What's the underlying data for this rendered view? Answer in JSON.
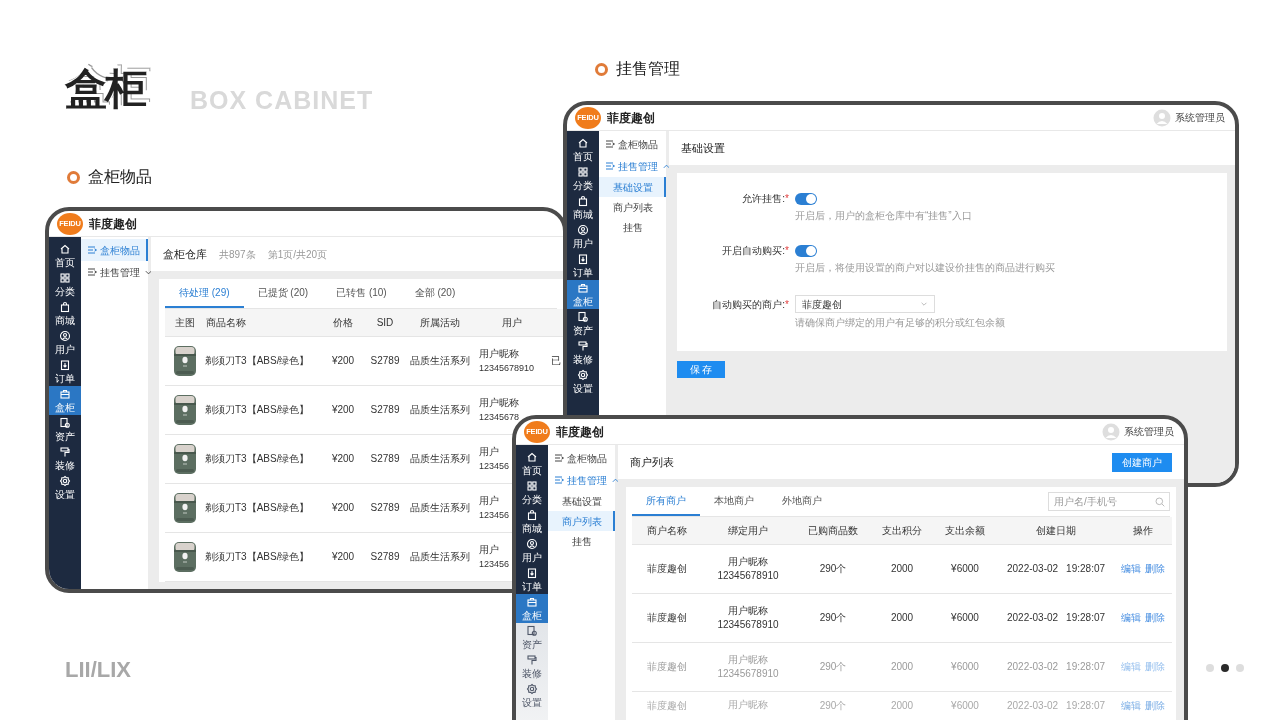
{
  "brand": {
    "title": "盒柜",
    "subtitle": "BOX CABINET"
  },
  "sections": [
    {
      "label": "盒柜物品"
    },
    {
      "label": "挂售管理"
    }
  ],
  "footer_mark": "LII/LIX",
  "pager": [
    {
      "selected": false
    },
    {
      "selected": true
    },
    {
      "selected": false
    }
  ],
  "tablets": [
    {
      "kind": "items",
      "app": {
        "logo": "FEIDU",
        "name": "菲度趣创"
      },
      "rail": [
        {
          "label": "首页",
          "selected": false
        },
        {
          "label": "分类",
          "selected": false
        },
        {
          "label": "商城",
          "selected": false
        },
        {
          "label": "用户",
          "selected": false
        },
        {
          "label": "订单",
          "selected": false
        },
        {
          "label": "盒柜",
          "selected": true
        },
        {
          "label": "资产",
          "selected": false
        },
        {
          "label": "装修",
          "selected": false
        },
        {
          "label": "设置",
          "selected": false
        }
      ],
      "subnav": [
        {
          "label": "盒柜物品",
          "selected": true
        },
        {
          "label": "挂售管理",
          "selected": false,
          "expanded": false
        }
      ],
      "page": {
        "title": "盒柜仓库",
        "meta": [
          "共897条",
          "第1页/共20页"
        ],
        "tabs": [
          {
            "label": "待处理 (29)",
            "selected": true
          },
          {
            "label": "已提货 (20)",
            "selected": false
          },
          {
            "label": "已转售 (10)",
            "selected": false
          },
          {
            "label": "全部 (20)",
            "selected": false
          }
        ],
        "columns": [
          "主图",
          "商品名称",
          "价格",
          "SID",
          "所属活动",
          "用户"
        ],
        "rows": [
          {
            "name": "剃须刀T3【ABS/绿色】",
            "price": "¥200",
            "sid": "S2789",
            "activity": "品质生活系列",
            "user": [
              "用户昵称",
              "12345678910"
            ],
            "column_7": "已"
          },
          {
            "name": "剃须刀T3【ABS/绿色】",
            "price": "¥200",
            "sid": "S2789",
            "activity": "品质生活系列",
            "user": [
              "用户昵称",
              "12345678"
            ]
          },
          {
            "name": "剃须刀T3【ABS/绿色】",
            "price": "¥200",
            "sid": "S2789",
            "activity": "品质生活系列",
            "user": [
              "用户",
              "123456"
            ]
          },
          {
            "name": "剃须刀T3【ABS/绿色】",
            "price": "¥200",
            "sid": "S2789",
            "activity": "品质生活系列",
            "user": [
              "用户",
              "123456"
            ]
          },
          {
            "name": "剃须刀T3【ABS/绿色】",
            "price": "¥200",
            "sid": "S2789",
            "activity": "品质生活系列",
            "user": [
              "用户",
              "123456"
            ]
          }
        ]
      }
    },
    {
      "kind": "settings",
      "app": {
        "logo": "FEIDU",
        "name": "菲度趣创",
        "user": "系统管理员"
      },
      "rail": [
        {
          "label": "首页",
          "selected": false
        },
        {
          "label": "分类",
          "selected": false
        },
        {
          "label": "商城",
          "selected": false
        },
        {
          "label": "用户",
          "selected": false
        },
        {
          "label": "订单",
          "selected": false
        },
        {
          "label": "盒柜",
          "selected": true
        },
        {
          "label": "资产",
          "selected": false
        },
        {
          "label": "装修",
          "selected": false
        },
        {
          "label": "设置",
          "selected": false
        }
      ],
      "subnav": [
        {
          "label": "盒柜物品",
          "selected": false
        },
        {
          "label": "挂售管理",
          "selected": false,
          "expanded": true,
          "children": [
            {
              "label": "基础设置",
              "selected": true
            },
            {
              "label": "商户列表",
              "selected": false
            },
            {
              "label": "挂售",
              "selected": false
            }
          ]
        }
      ],
      "page": {
        "title": "基础设置",
        "fields": [
          {
            "kind": "toggle",
            "label": "允许挂售:",
            "required_mark": "*",
            "on": true,
            "hint": "开启后，用户的盒柜仓库中有“挂售”入口"
          },
          {
            "kind": "toggle",
            "label": "开启自动购买:",
            "required_mark": "*",
            "on": true,
            "hint": "开启后，将使用设置的商户对以建设价挂售的商品进行购买"
          },
          {
            "kind": "select",
            "label": "自动购买的商户:",
            "required_mark": "*",
            "value": "菲度趣创",
            "hint": "请确保商户绑定的用户有足够的积分或红包余额"
          }
        ],
        "save": "保 存"
      }
    },
    {
      "kind": "merchants",
      "app": {
        "logo": "FEIDU",
        "name": "菲度趣创",
        "user": "系统管理员"
      },
      "rail_fade": true,
      "rail": [
        {
          "label": "首页",
          "selected": false,
          "faded": false
        },
        {
          "label": "分类",
          "selected": false,
          "faded": false
        },
        {
          "label": "商城",
          "selected": false,
          "faded": false
        },
        {
          "label": "用户",
          "selected": false,
          "faded": false
        },
        {
          "label": "订单",
          "selected": false,
          "faded": false
        },
        {
          "label": "盒柜",
          "selected": true,
          "faded": false
        },
        {
          "label": "资产",
          "selected": false,
          "faded": true
        },
        {
          "label": "装修",
          "selected": false,
          "faded": true
        },
        {
          "label": "设置",
          "selected": false,
          "faded": true
        }
      ],
      "subnav": [
        {
          "label": "盒柜物品",
          "selected": false
        },
        {
          "label": "挂售管理",
          "selected": false,
          "expanded": true,
          "children": [
            {
              "label": "基础设置",
              "selected": false
            },
            {
              "label": "商户列表",
              "selected": true
            },
            {
              "label": "挂售",
              "selected": false
            }
          ]
        }
      ],
      "page": {
        "title": "商户列表",
        "action": "创建商户",
        "tabs": [
          {
            "label": "所有商户",
            "selected": true
          },
          {
            "label": "本地商户",
            "selected": false
          },
          {
            "label": "外地商户",
            "selected": false
          }
        ],
        "search": {
          "placeholder": "用户名/手机号"
        },
        "columns": [
          "商户名称",
          "绑定用户",
          "已购商品数",
          "支出积分",
          "支出余额",
          "创建日期",
          "操作"
        ],
        "rows": [
          {
            "kind": "normal",
            "name": "菲度趣创",
            "user": [
              "用户昵称",
              "12345678910"
            ],
            "count": "290个",
            "points": "2000",
            "balance": "¥6000",
            "date": "2022-03-02",
            "time": "19:28:07",
            "actions": [
              "编辑",
              "删除"
            ]
          },
          {
            "kind": "normal",
            "name": "菲度趣创",
            "user": [
              "用户昵称",
              "12345678910"
            ],
            "count": "290个",
            "points": "2000",
            "balance": "¥6000",
            "date": "2022-03-02",
            "time": "19:28:07",
            "actions": [
              "编辑",
              "删除"
            ]
          },
          {
            "kind": "faded",
            "name": "菲度趣创",
            "user": [
              "用户昵称",
              "12345678910"
            ],
            "count": "290个",
            "points": "2000",
            "balance": "¥6000",
            "date": "2022-03-02",
            "time": "19:28:07",
            "actions": [
              "编辑",
              "删除"
            ]
          },
          {
            "kind": "faint",
            "name": "菲度趣创",
            "user": [
              "用户昵称"
            ],
            "count": "290个",
            "points": "2000",
            "balance": "¥6000",
            "date": "2022-03-02",
            "time": "19:28:07",
            "actions": [
              "编辑",
              "删除"
            ]
          }
        ]
      }
    }
  ]
}
